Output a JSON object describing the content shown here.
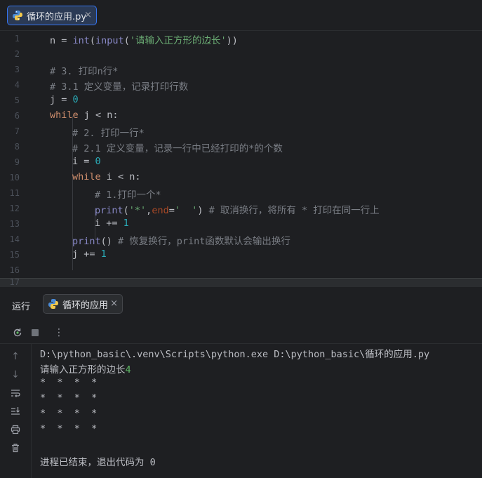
{
  "editor_tab": {
    "title": "循环的应用.py",
    "close": "×"
  },
  "line_numbers": [
    "1",
    "2",
    "3",
    "4",
    "5",
    "6",
    "7",
    "8",
    "9",
    "10",
    "11",
    "12",
    "13",
    "14",
    "15",
    "16"
  ],
  "split_line_number": "17",
  "code": {
    "l1": {
      "a": "n = ",
      "b": "int",
      "c": "(",
      "d": "input",
      "e": "(",
      "f": "'请输入正方形的边长'",
      "g": "))"
    },
    "l3": "# 3. 打印n行*",
    "l4": "# 3.1 定义变量，记录打印行数",
    "l5": {
      "a": "j = ",
      "b": "0"
    },
    "l6": {
      "a": "while",
      "b": " j < n:"
    },
    "l7": "# 2. 打印一行*",
    "l8": "# 2.1 定义变量，记录一行中已经打印的*的个数",
    "l9": {
      "a": "i = ",
      "b": "0"
    },
    "l10": {
      "a": "while",
      "b": " i < n:"
    },
    "l11": "# 1.打印一个*",
    "l12": {
      "a": "print",
      "b": "(",
      "c": "'*'",
      "d": ",",
      "e": "end",
      "f": "=",
      "g": "'  '",
      "h": ") ",
      "i": "# 取消换行，将所有 * 打印在同一行上"
    },
    "l13": {
      "a": "i += ",
      "b": "1"
    },
    "l14": {
      "a": "print",
      "b": "() ",
      "c": "# 恢复换行，print函数默认会输出换行"
    },
    "l15": {
      "a": "j += ",
      "b": "1"
    }
  },
  "run_panel": {
    "label": "运行",
    "tab_title": "循环的应用",
    "tab_close": "×",
    "toolbar": {
      "rerun_icon": "rerun-icon",
      "stop_icon": "stop-icon",
      "more_icon": "more-icon"
    },
    "output": {
      "cmd": "D:\\python_basic\\.venv\\Scripts\\python.exe D:\\python_basic\\循环的应用.py",
      "prompt": "请输入正方形的边长",
      "user_input": "4",
      "rows": [
        "*  *  *  *",
        "*  *  *  *",
        "*  *  *  *",
        "*  *  *  *"
      ],
      "exit_msg": "进程已结束，退出代码为 0"
    }
  },
  "colors": {
    "keyword": "#cf8e6d",
    "builtin": "#8888c6",
    "string": "#6aab73",
    "number": "#2aacb8",
    "comment": "#7a7e85",
    "accent": "#3574f0"
  }
}
